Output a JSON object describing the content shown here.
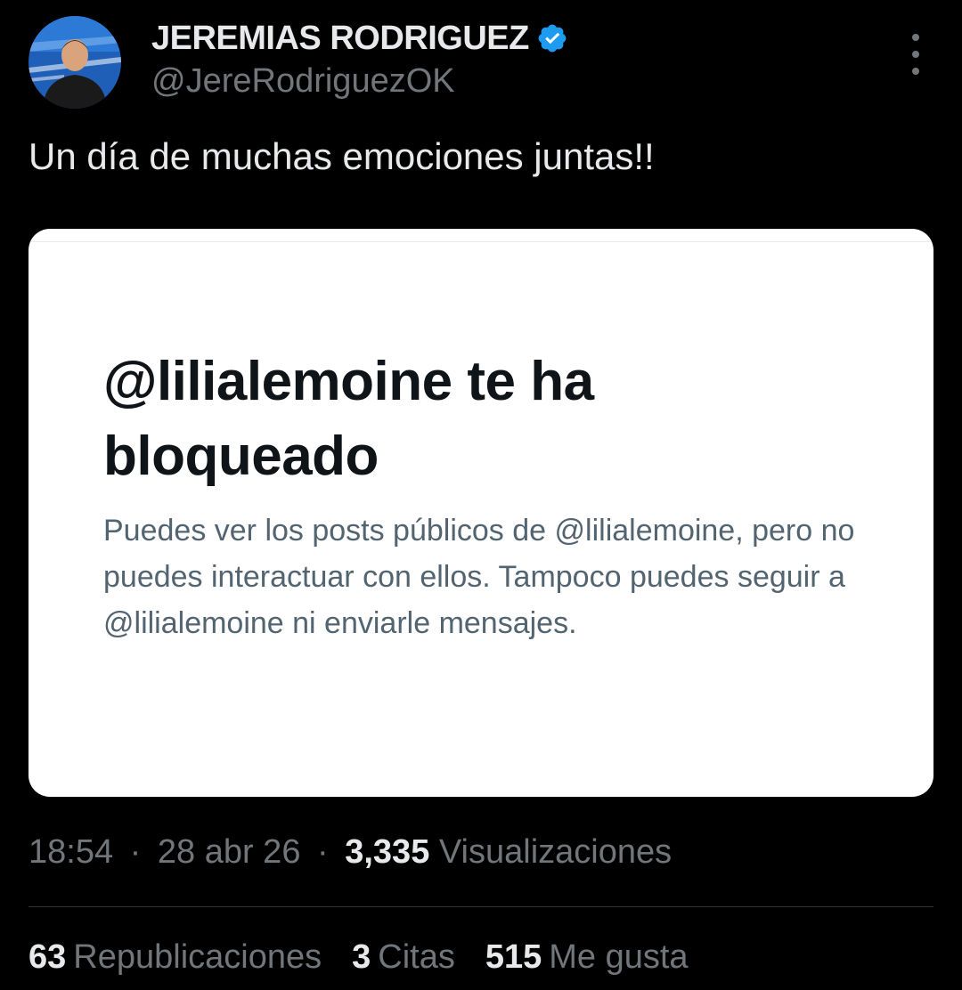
{
  "author": {
    "name": "JEREMIAS RODRIGUEZ",
    "handle": "@JereRodriguezOK",
    "verified_color": "#1d9bf0"
  },
  "tweet": {
    "text": "Un día de muchas emociones juntas!!"
  },
  "media_card": {
    "title": "@lilialemoine te ha bloqueado",
    "body": "Puedes ver los posts públicos de @lilialemoine, pero no puedes interactuar con ellos. Tampoco puedes seguir a @lilialemoine ni enviarle mensajes."
  },
  "meta": {
    "time": "18:54",
    "separator": "·",
    "date": "28 abr 26",
    "views_count": "3,335",
    "views_label": "Visualizaciones"
  },
  "stats": [
    {
      "count": "63",
      "label": "Republicaciones"
    },
    {
      "count": "3",
      "label": "Citas"
    },
    {
      "count": "515",
      "label": "Me gusta"
    }
  ],
  "icons": {
    "more": "more-options-icon",
    "verified": "verified-badge-icon"
  }
}
